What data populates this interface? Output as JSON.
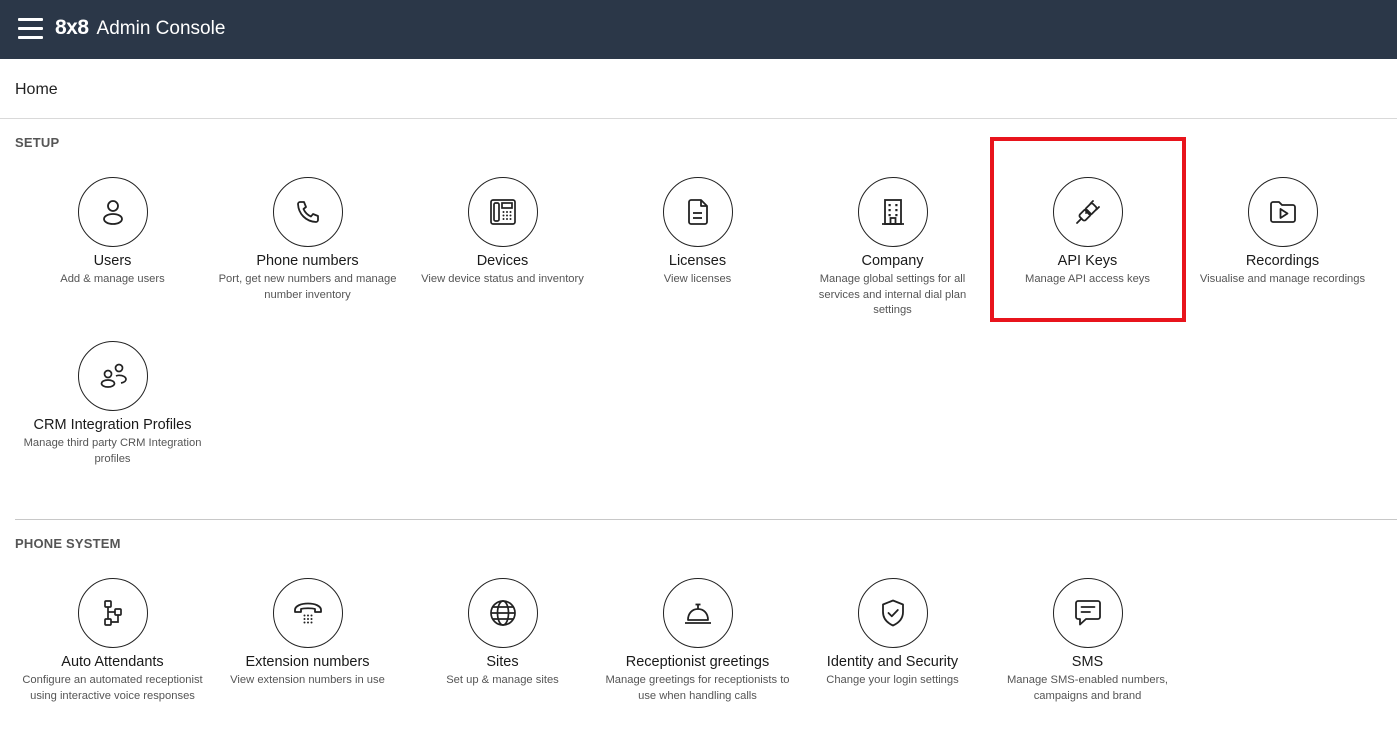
{
  "header": {
    "logo": "8x8",
    "title": "Admin Console"
  },
  "breadcrumb": "Home",
  "sections": {
    "setup": {
      "title": "SETUP",
      "tiles": [
        {
          "label": "Users",
          "desc": "Add & manage users",
          "icon": "user-icon"
        },
        {
          "label": "Phone numbers",
          "desc": "Port, get new numbers and manage number inventory",
          "icon": "phone-icon"
        },
        {
          "label": "Devices",
          "desc": "View device status and inventory",
          "icon": "desk-phone-icon"
        },
        {
          "label": "Licenses",
          "desc": "View licenses",
          "icon": "document-icon"
        },
        {
          "label": "Company",
          "desc": "Manage global settings for all services and internal dial plan settings",
          "icon": "building-icon"
        },
        {
          "label": "API Keys",
          "desc": "Manage API access keys",
          "icon": "plug-icon"
        },
        {
          "label": "Recordings",
          "desc": "Visualise and manage recordings",
          "icon": "video-folder-icon"
        },
        {
          "label": "CRM Integration Profiles",
          "desc": "Manage third party CRM Integration profiles",
          "icon": "people-icon"
        }
      ]
    },
    "phone_system": {
      "title": "PHONE SYSTEM",
      "tiles": [
        {
          "label": "Auto Attendants",
          "desc": "Configure an automated receptionist using interactive voice responses",
          "icon": "flow-icon"
        },
        {
          "label": "Extension numbers",
          "desc": "View extension numbers in use",
          "icon": "dialpad-phone-icon"
        },
        {
          "label": "Sites",
          "desc": "Set up & manage sites",
          "icon": "globe-icon"
        },
        {
          "label": "Receptionist greetings",
          "desc": "Manage greetings for receptionists to use when handling calls",
          "icon": "service-bell-icon"
        },
        {
          "label": "Identity and Security",
          "desc": "Change your login settings",
          "icon": "shield-check-icon"
        },
        {
          "label": "SMS",
          "desc": "Manage SMS-enabled numbers, campaigns and brand",
          "icon": "message-icon"
        }
      ]
    }
  },
  "colors": {
    "topbar": "#2b3748",
    "highlight": "#e8141c"
  }
}
